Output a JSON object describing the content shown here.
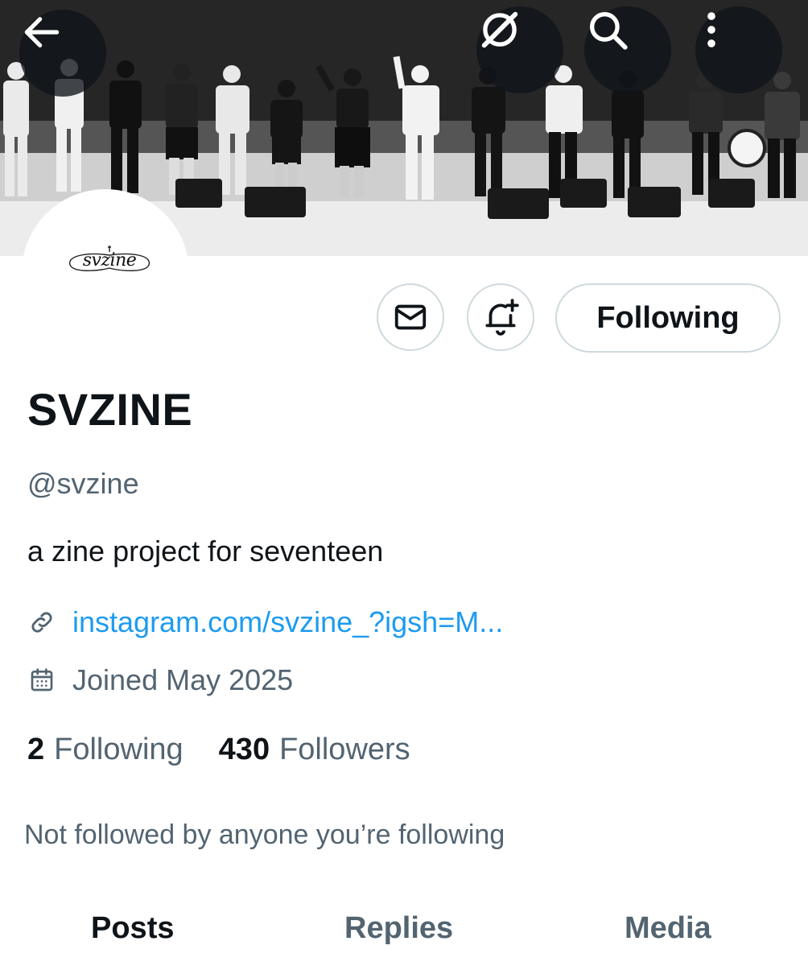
{
  "header": {
    "back_icon": "arrow-left-icon",
    "grok_icon": "grok-icon",
    "search_icon": "search-icon",
    "more_icon": "more-vertical-icon"
  },
  "avatar": {
    "logo_text": "svzine"
  },
  "actions": {
    "message_icon": "envelope-icon",
    "notify_icon": "bell-plus-icon",
    "follow_label": "Following"
  },
  "profile": {
    "name": "SVZINE",
    "handle": "@svzine",
    "bio": "a zine project for seventeen",
    "link": "instagram.com/svzine_?igsh=M...",
    "joined": "Joined May 2025",
    "following_count": "2",
    "following_label": "Following",
    "followers_count": "430",
    "followers_label": "Followers",
    "mutuals_note": "Not followed by anyone you’re following"
  },
  "tabs": [
    {
      "label": "Posts",
      "active": true
    },
    {
      "label": "Replies",
      "active": false
    },
    {
      "label": "Media",
      "active": false
    }
  ],
  "colors": {
    "text_primary": "#0f1419",
    "text_secondary": "#536471",
    "link": "#1d9bf0",
    "border": "#cfd9de"
  }
}
